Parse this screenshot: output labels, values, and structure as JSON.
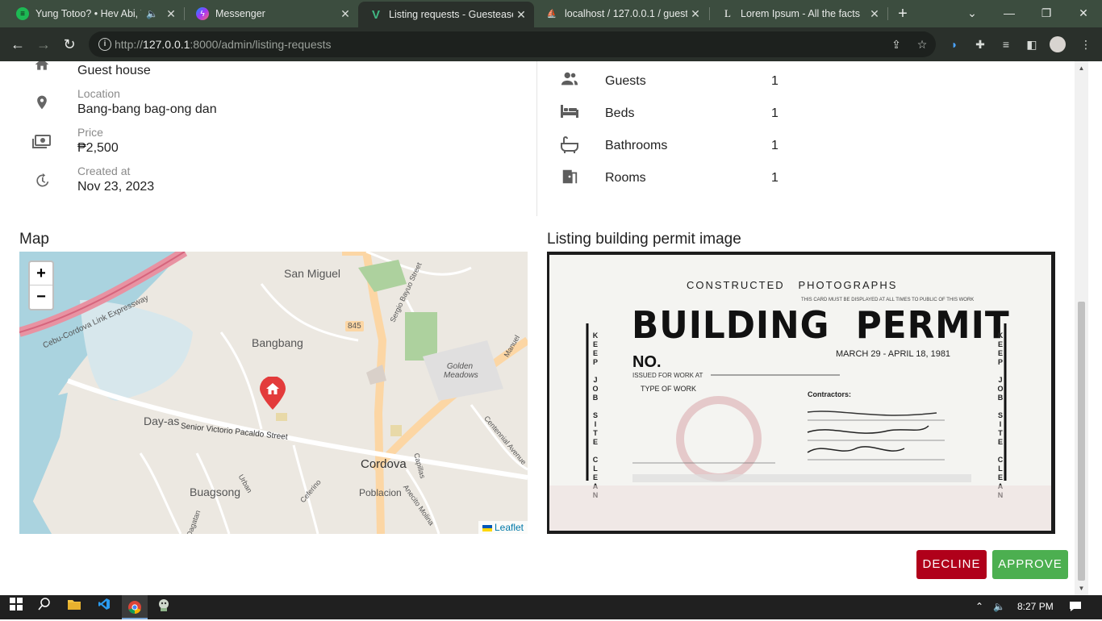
{
  "browser": {
    "tabs": [
      {
        "label": "Yung Totoo? • Hev Abi, T",
        "icon": "spotify-icon",
        "color": "#1db954",
        "audio": true
      },
      {
        "label": "Messenger",
        "icon": "messenger-icon",
        "color": "#a334fa"
      },
      {
        "label": "Listing requests - Guestease",
        "icon": "vue-icon",
        "color": "#41b883",
        "active": true
      },
      {
        "label": "localhost / 127.0.0.1 / guest",
        "icon": "phpmyadmin-icon",
        "color": "#f29111"
      },
      {
        "label": "Lorem Ipsum - All the facts",
        "icon": "lorem-icon",
        "color": "#ffffff"
      }
    ],
    "new_tab": "+",
    "url_prefix": "http://",
    "url_host": "127.0.0.1",
    "url_rest": ":8000/admin/listing-requests"
  },
  "listing": {
    "type_value": "Guest house",
    "location_label": "Location",
    "location_value": "Bang-bang bag-ong dan",
    "price_label": "Price",
    "price_value": "₱2,500",
    "created_label": "Created at",
    "created_value": "Nov 23, 2023"
  },
  "amenities": [
    {
      "name": "Guests",
      "value": "1",
      "icon": "people-icon"
    },
    {
      "name": "Beds",
      "value": "1",
      "icon": "bed-icon"
    },
    {
      "name": "Bathrooms",
      "value": "1",
      "icon": "bathtub-icon"
    },
    {
      "name": "Rooms",
      "value": "1",
      "icon": "door-icon"
    }
  ],
  "map": {
    "title": "Map",
    "zoom_in": "+",
    "zoom_out": "−",
    "attribution": "Leaflet",
    "labels": [
      "San Miguel",
      "Bangbang",
      "845",
      "Sergio Bayuo Street",
      "Golden Meadows",
      "Cebu-Cordova Link Expressway",
      "Day-as",
      "Senior Victorio Pacaldo Street",
      "Cordova",
      "Buagsong",
      "Poblacion",
      "Urban",
      "Dagatan",
      "Manuel",
      "Centennial Avenue",
      "Capillas",
      "Anecito Molina",
      "Ceferino"
    ]
  },
  "permit": {
    "title": "Listing building permit image",
    "header": "CONSTRUCTED   PHOTOGRAPHS",
    "subheader": "THIS CARD MUST BE DISPLAYED AT ALL TIMES TO PUBLIC OF THIS WORK",
    "main": "BUILDING  PERMIT",
    "no": "NO.",
    "dates": "MARCH 29 - APRIL 18, 1981",
    "issued": "ISSUED FOR WORK AT",
    "work_type": "TYPE OF WORK",
    "contractors": "Contractors:",
    "side_text": "KEEP JOB SITE CLEAN"
  },
  "actions": {
    "decline": "DECLINE",
    "approve": "APPROVE"
  },
  "taskbar": {
    "time": "8:27 PM"
  }
}
